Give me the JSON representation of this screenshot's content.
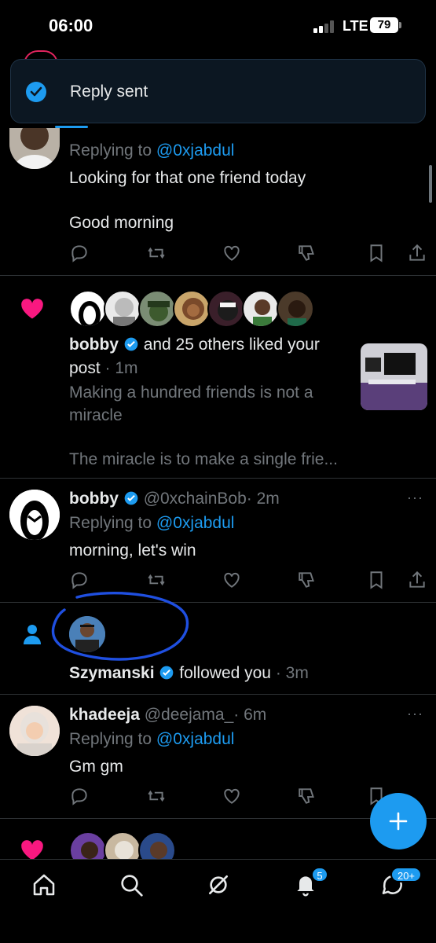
{
  "status_bar": {
    "time": "06:00",
    "network": "LTE",
    "battery": "79"
  },
  "toast": {
    "text": "Reply sent"
  },
  "notifications": [
    {
      "type": "reply",
      "replying_prefix": "Replying to ",
      "replying_to": "@0xjabdul",
      "body_line1": "Looking for that one friend today",
      "body_line2": "Good morning"
    },
    {
      "type": "like",
      "user": "bobby",
      "action": "and 25 others liked your",
      "action_line2": "post",
      "time": "· 1m",
      "post_line1": "Making a hundred friends is not a",
      "post_line2": "miracle",
      "post_line3": "The miracle is to make a single frie..."
    },
    {
      "type": "reply",
      "user": "bobby",
      "handle": "@0xchainBob",
      "time": "· 2m",
      "replying_prefix": "Replying to ",
      "replying_to": "@0xjabdul",
      "body": "morning, let's win",
      "more": "···"
    },
    {
      "type": "follow",
      "user": "Szymanski",
      "action": "followed you",
      "time": "· 3m"
    },
    {
      "type": "reply",
      "user": "khadeeja",
      "handle": "@deejama_",
      "time": "· 6m",
      "replying_prefix": "Replying to ",
      "replying_to": "@0xjabdul",
      "body": "Gm gm",
      "more": "···"
    }
  ],
  "nav": {
    "items": [
      "home-icon",
      "search-icon",
      "grok-icon",
      "notifications-icon",
      "messages-icon"
    ],
    "notifications_badge": "5",
    "messages_badge": "20+"
  },
  "colors": {
    "accent": "#1d9bf0",
    "like": "#f91880",
    "background": "#000000",
    "annotation": "#1d4ed8"
  }
}
